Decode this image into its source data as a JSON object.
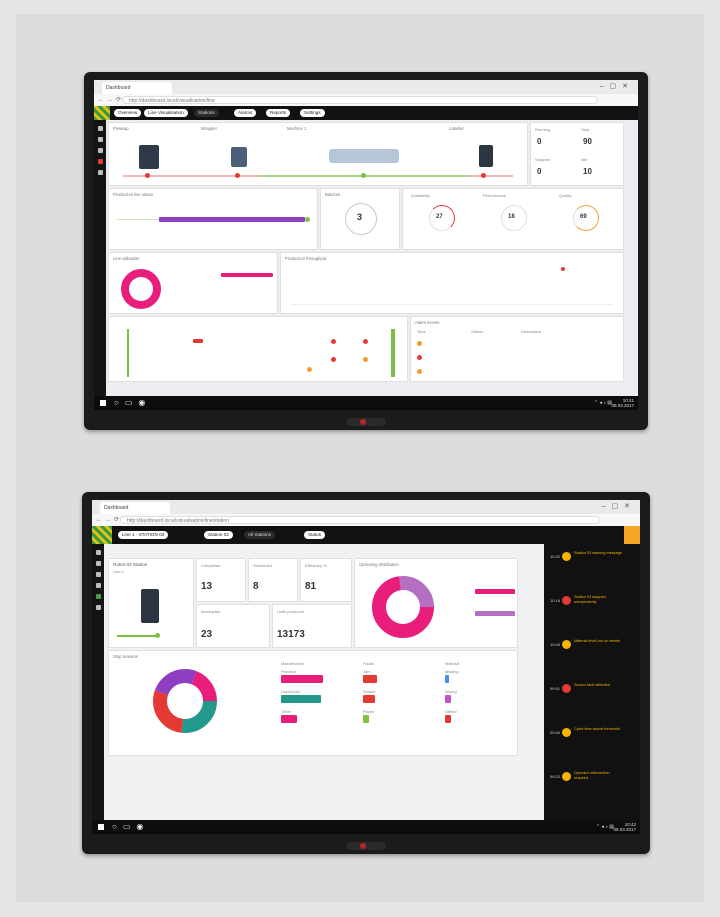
{
  "monitor_top": {
    "browser": {
      "tab_title": "Dashboard",
      "url": "http://dashboard.local/visualisation/line"
    },
    "app_tabs": [
      "Overview",
      "Line Visualisation",
      "Stations",
      "Alarms",
      "Reports",
      "Settings"
    ],
    "machines_panel": {
      "labels": [
        "Prewrap",
        "Wrapper",
        "Machine 1",
        "Labeller"
      ],
      "kpis": [
        {
          "label": "Running",
          "value": "0"
        },
        {
          "label": "Total",
          "value": "90"
        },
        {
          "label": "Stopped",
          "value": "0"
        },
        {
          "label": "Idle",
          "value": "10"
        }
      ]
    },
    "progress_panel": {
      "title": "Production line status"
    },
    "counter_panel": {
      "title": "Batches",
      "value": "3"
    },
    "gauges": [
      {
        "label": "Availability",
        "value": "27"
      },
      {
        "label": "Performance",
        "value": "18"
      },
      {
        "label": "Quality",
        "value": "69"
      }
    ],
    "donut_panel": {
      "title": "Line utilisation"
    },
    "chart_panel": {
      "title": "Production throughput"
    },
    "table_panel": {
      "title": "Alarm events",
      "columns": [
        "Time",
        "Station",
        "Description"
      ]
    },
    "taskbar": {
      "time": "10:41",
      "date": "08.03.2017"
    }
  },
  "monitor_bottom": {
    "browser": {
      "tab_title": "Dashboard",
      "url": "http://dashboard.local/visualisation/line/station"
    },
    "app_tabs": [
      "Line 1 - STATION 03",
      "Station 03",
      "All Stations",
      "Status"
    ],
    "machine_card": {
      "name": "Robot 03 Station",
      "subtitle": "Line 1"
    },
    "kpis": [
      {
        "label": "Completed",
        "value": "13"
      },
      {
        "label": "Scheduled",
        "value": "8"
      },
      {
        "label": "Efficiency %",
        "value": "81"
      },
      {
        "label": "Interrupted",
        "value": "23"
      },
      {
        "label": "Units produced",
        "value": "13173"
      }
    ],
    "donut_top_title": "Operating distribution",
    "breakdown_title": "Stop reasons",
    "bar_groups": [
      {
        "title": "Maintenance",
        "labels": [
          "Planned",
          "Unplanned",
          "Other"
        ]
      },
      {
        "title": "Faults",
        "labels": [
          "Jam",
          "Sensor",
          "Power"
        ]
      },
      {
        "title": "Material",
        "labels": [
          "Missing",
          "Wrong",
          "Defect"
        ]
      }
    ],
    "timeline": [
      {
        "time": "10:32",
        "type": "warning",
        "text": "Station 03 warning message"
      },
      {
        "time": "10:18",
        "type": "error",
        "text": "Station 03 stopped unexpectedly"
      },
      {
        "time": "10:05",
        "type": "warning",
        "text": "Material level low on feeder"
      },
      {
        "time": "09:51",
        "type": "error",
        "text": "Sensor fault detected"
      },
      {
        "time": "09:40",
        "type": "warning",
        "text": "Cycle time above threshold"
      },
      {
        "time": "09:22",
        "type": "warning",
        "text": "Operator intervention required"
      }
    ],
    "taskbar": {
      "time": "10:42",
      "date": "08.03.2017"
    }
  },
  "colors": {
    "magenta": "#e91e7c",
    "purple": "#8e3fbf",
    "teal": "#23998e",
    "orange": "#f39c34",
    "red": "#e53935",
    "green": "#7cc142",
    "amber": "#f5b400"
  }
}
